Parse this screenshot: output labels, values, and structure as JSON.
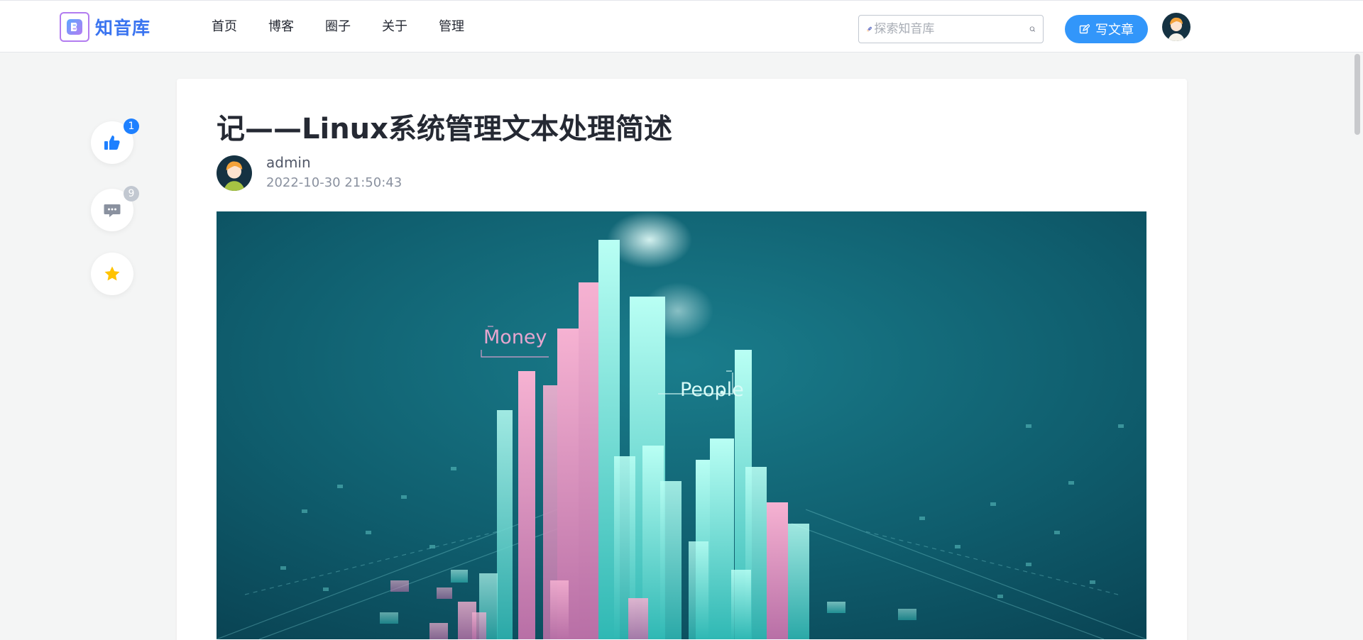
{
  "brand": {
    "name": "知音库",
    "logo_icon": "logo-b-icon",
    "accent": "#3a74f0"
  },
  "nav": {
    "items": [
      {
        "label": "首页"
      },
      {
        "label": "博客"
      },
      {
        "label": "圈子"
      },
      {
        "label": "关于"
      },
      {
        "label": "管理"
      }
    ]
  },
  "search": {
    "placeholder": "探索知音库",
    "value": "",
    "icon": "search-icon",
    "decor_icon": "rocket-icon"
  },
  "write_button": {
    "label": "写文章",
    "icon": "edit-icon",
    "color": "#3296fa"
  },
  "actions": {
    "like": {
      "icon": "thumbs-up-icon",
      "count": "1",
      "badge_color": "#1e80ff"
    },
    "comment": {
      "icon": "comment-icon",
      "count": "9",
      "badge_color": "#c2c8d1"
    },
    "favorite": {
      "icon": "star-icon",
      "color": "#ffc300"
    }
  },
  "article": {
    "title": "记——Linux系统管理文本处理简述",
    "author": "admin",
    "published_at": "2022-10-30 21:50:43",
    "cover": {
      "labels": {
        "left": "Money",
        "right": "People"
      },
      "background": "#0e5a68"
    }
  }
}
